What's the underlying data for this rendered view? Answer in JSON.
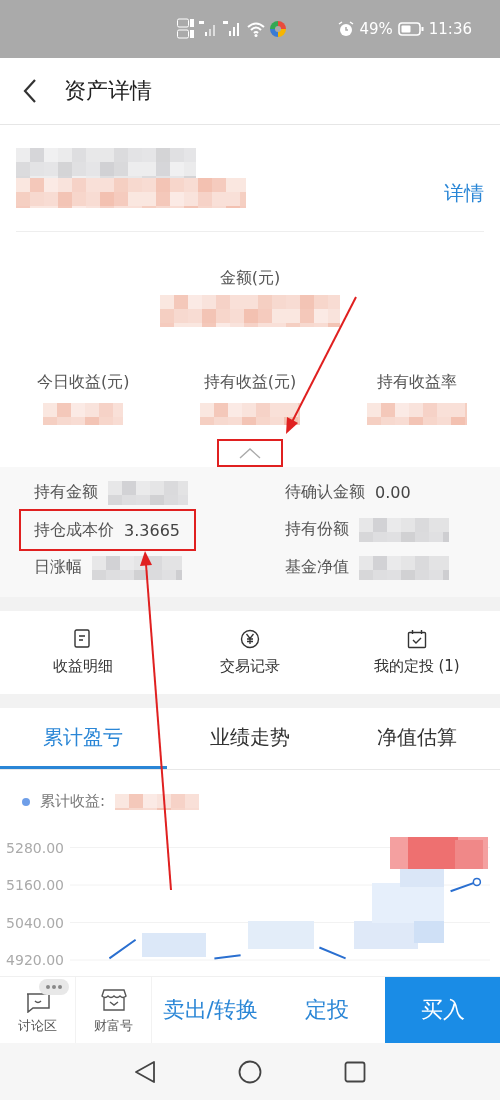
{
  "status_bar": {
    "battery": "49%",
    "time": "11:36"
  },
  "header": {
    "title": "资产详情"
  },
  "fund": {
    "name_hidden": true,
    "detail_link": "详情"
  },
  "summary": {
    "amount_label": "金额(元)",
    "amount_hidden": true,
    "metrics": [
      {
        "label": "今日收益(元)",
        "value_hidden": true
      },
      {
        "label": "持有收益(元)",
        "value_hidden": true
      },
      {
        "label": "持有收益率",
        "value_hidden": true
      }
    ],
    "collapse": {
      "expanded": true,
      "highlighted": true
    }
  },
  "details": [
    {
      "label": "持有金额",
      "value_hidden": true,
      "highlighted": false
    },
    {
      "label": "待确认金额",
      "value": "0.00",
      "highlighted": false
    },
    {
      "label": "持仓成本价",
      "value": "3.3665",
      "highlighted": true
    },
    {
      "label": "持有份额",
      "value_hidden": true,
      "highlighted": false
    },
    {
      "label": "日涨幅",
      "value_hidden": true,
      "highlighted": false
    },
    {
      "label": "基金净值",
      "value_hidden": true,
      "highlighted": false
    }
  ],
  "actions": [
    {
      "kind": "document",
      "label": "收益明细"
    },
    {
      "kind": "yen",
      "label": "交易记录"
    },
    {
      "kind": "calendar",
      "label": "我的定投 (1)"
    }
  ],
  "tabs": [
    {
      "label": "累计盈亏",
      "selected": true
    },
    {
      "label": "业绩走势",
      "selected": false
    },
    {
      "label": "净值估算",
      "selected": false
    }
  ],
  "chart": {
    "legend": "累计收益:",
    "legend_value_hidden": true,
    "chart_data": {
      "type": "line",
      "categories": [
        null,
        null,
        null,
        null,
        null,
        null,
        null,
        null,
        null,
        null,
        null,
        null,
        null,
        null,
        null,
        null
      ],
      "grid": true,
      "ylim": [
        4920,
        5280
      ],
      "yticks": [
        {
          "value": 4920,
          "label": "4920.00"
        },
        {
          "value": 5040,
          "label": "5040.00"
        },
        {
          "value": 5160,
          "label": "5160.00"
        },
        {
          "value": 5280,
          "label": "5280.00"
        }
      ],
      "series": [
        {
          "color": "#2a6fd0",
          "values": [
            null,
            4925,
            4985,
            null,
            null,
            4925,
            4935,
            null,
            null,
            4960,
            4925,
            null,
            null,
            null,
            5140,
            5170
          ]
        }
      ]
    }
  },
  "bottom_bar": {
    "tools": [
      {
        "kind": "chat",
        "label": "讨论区",
        "badge": true
      },
      {
        "kind": "store",
        "label": "财富号",
        "badge": false
      }
    ],
    "buttons": [
      {
        "kind": "text",
        "label": "卖出/转换"
      },
      {
        "kind": "text",
        "label": "定投"
      },
      {
        "kind": "primary",
        "label": "买入"
      }
    ]
  }
}
